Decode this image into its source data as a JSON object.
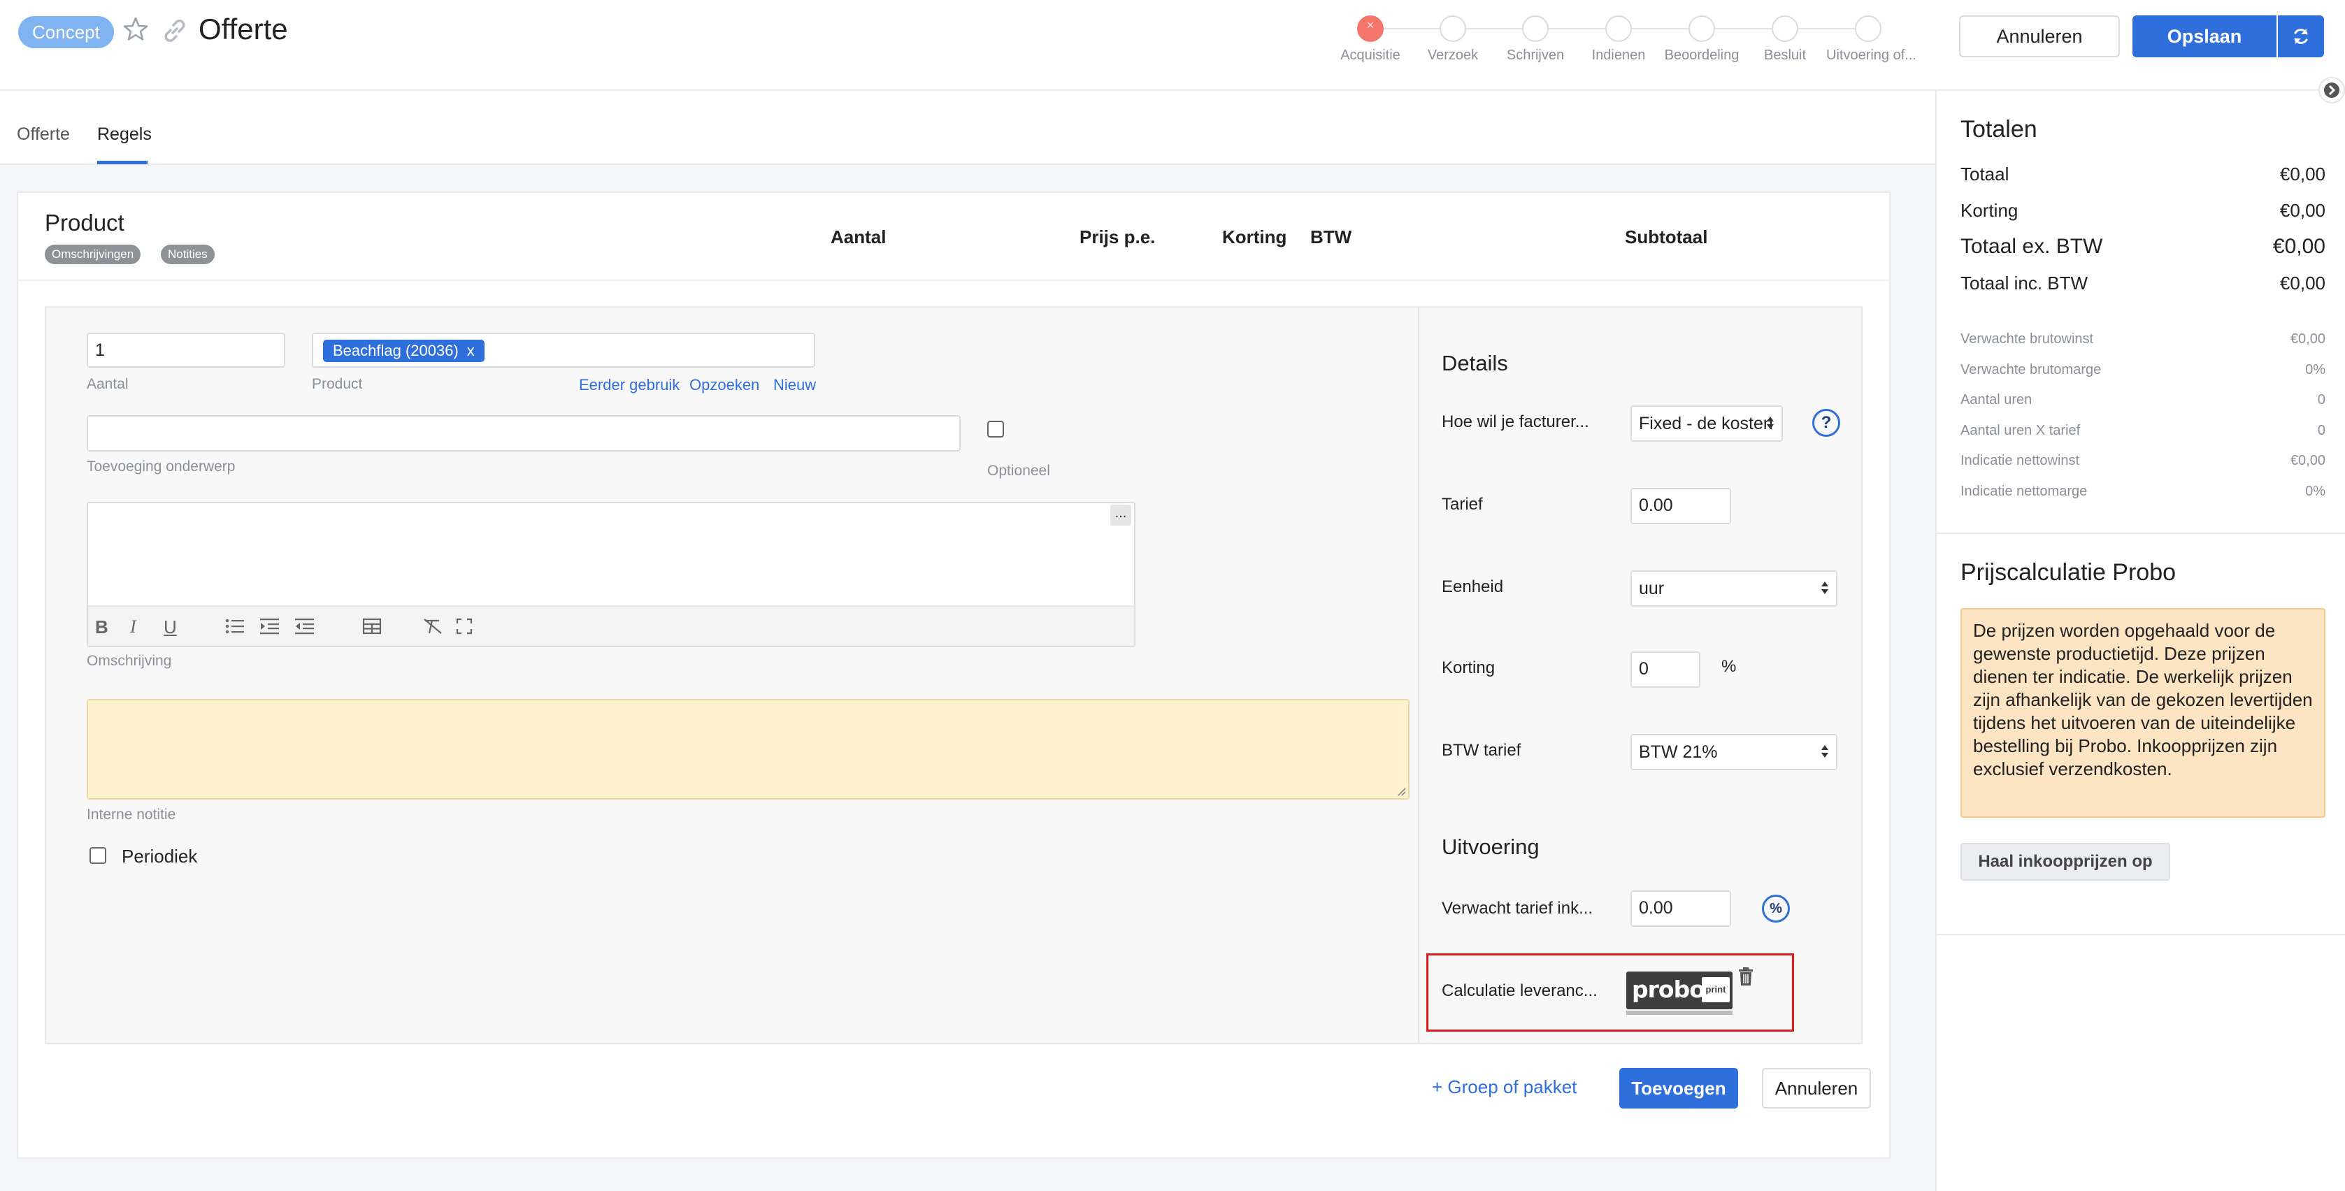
{
  "header": {
    "status_badge": "Concept",
    "title": "Offerte",
    "steps": [
      "Acquisitie",
      "Verzoek",
      "Schrijven",
      "Indienen",
      "Beoordeling",
      "Besluit",
      "Uitvoering of..."
    ],
    "cancel_label": "Annuleren",
    "save_label": "Opslaan"
  },
  "tabs": [
    "Offerte",
    "Regels"
  ],
  "active_tab": "Regels",
  "table_header": {
    "product": "Product",
    "chips": [
      "Omschrijvingen",
      "Notities"
    ],
    "columns": [
      "Aantal",
      "Prijs p.e.",
      "Korting",
      "BTW",
      "Subtotaal"
    ]
  },
  "line_form": {
    "aantal_value": "1",
    "aantal_label": "Aantal",
    "product_tag": "Beachflag (20036)",
    "product_tag_remove": "x",
    "product_label": "Product",
    "links": [
      "Eerder gebruik",
      "Opzoeken",
      "Nieuw"
    ],
    "toevoeging_label": "Toevoeging onderwerp",
    "optioneel_label": "Optioneel",
    "editor_more": "...",
    "omschrijving_label": "Omschrijving",
    "interne_notitie_label": "Interne notitie",
    "periodiek_label": "Periodiek"
  },
  "details": {
    "title": "Details",
    "facturering_label": "Hoe wil je facturer...",
    "facturering_value": "Fixed - de kosten",
    "help": "?",
    "tarief_label": "Tarief",
    "tarief_value": "0.00",
    "eenheid_label": "Eenheid",
    "eenheid_value": "uur",
    "korting_label": "Korting",
    "korting_value": "0",
    "korting_suffix": "%",
    "btw_label": "BTW tarief",
    "btw_value": "BTW 21%"
  },
  "uitvoering": {
    "title": "Uitvoering",
    "verwacht_label": "Verwacht tarief ink...",
    "verwacht_value": "0.00",
    "pct_icon": "%",
    "calculatie_label": "Calculatie leveranc...",
    "logo_main": "probo",
    "logo_sub": "print"
  },
  "actions": {
    "groep": "+ Groep of pakket",
    "toevoegen": "Toevoegen",
    "annuleren": "Annuleren"
  },
  "totals": {
    "title": "Totalen",
    "main_rows": [
      {
        "label": "Totaal",
        "value": "€0,00"
      },
      {
        "label": "Korting",
        "value": "€0,00"
      },
      {
        "label": "Totaal ex. BTW",
        "value": "€0,00"
      },
      {
        "label": "Totaal inc. BTW",
        "value": "€0,00"
      }
    ],
    "detail_rows": [
      {
        "label": "Verwachte brutowinst",
        "value": "€0,00"
      },
      {
        "label": "Verwachte brutomarge",
        "value": "0%"
      },
      {
        "label": "Aantal uren",
        "value": "0"
      },
      {
        "label": "Aantal uren X tarief",
        "value": "0"
      },
      {
        "label": "Indicatie nettowinst",
        "value": "€0,00"
      },
      {
        "label": "Indicatie nettomarge",
        "value": "0%"
      }
    ]
  },
  "probo": {
    "title": "Prijscalculatie Probo",
    "note": "De prijzen worden opgehaald voor de gewenste productietijd. Deze prijzen dienen ter indicatie. De werkelijk prijzen zijn afhankelijk van de gekozen levertijden tijdens het uitvoeren van de uiteindelijke bestelling bij Probo. Inkoopprijzen zijn exclusief verzendkosten.",
    "button": "Haal inkoopprijzen op"
  },
  "colors": {
    "accent": "#2f6fdc",
    "active_step": "#f5776b",
    "note_bg": "#fff3cf",
    "probo_note_bg": "#fde5c4",
    "highlight": "#e01b1b"
  }
}
